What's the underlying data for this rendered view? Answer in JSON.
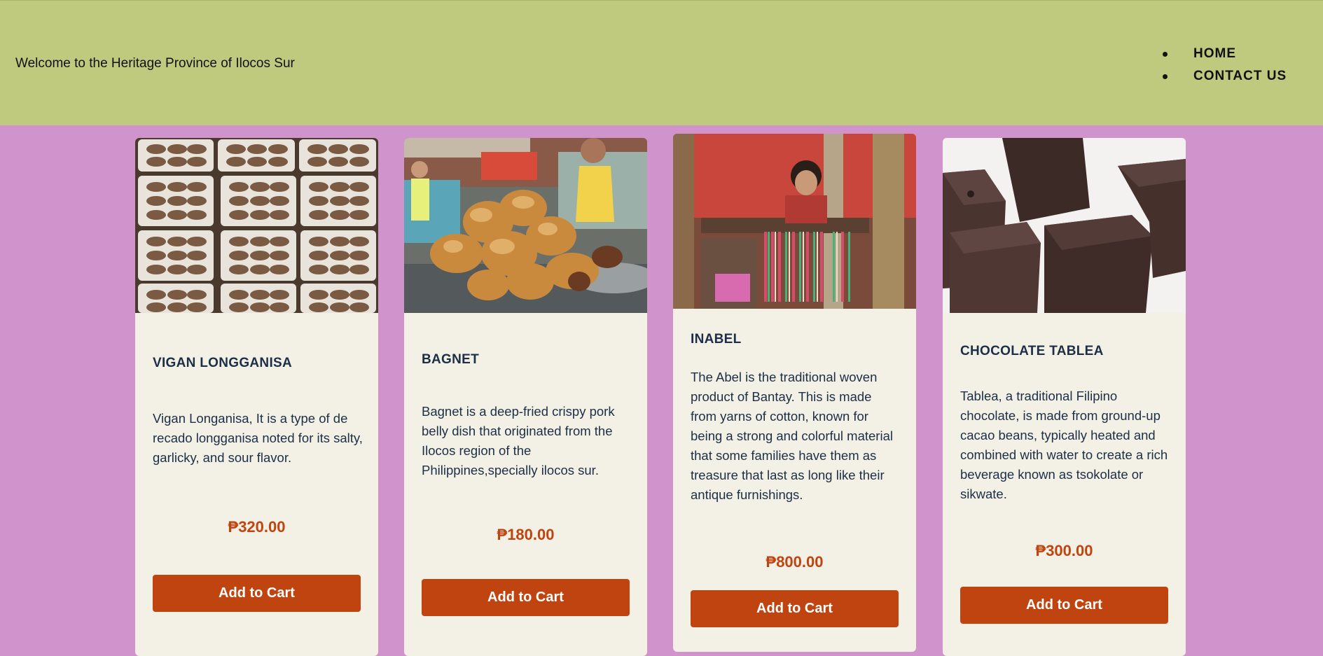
{
  "header": {
    "welcome_text": "Welcome to the Heritage Province of Ilocos Sur",
    "nav": [
      {
        "label": "HOME"
      },
      {
        "label": "CONTACT US"
      }
    ]
  },
  "currency": "₱",
  "products": [
    {
      "title": "VIGAN LONGGANISA",
      "description": "Vigan Longanisa, It is a type of de recado longganisa noted for its salty, garlicky, and sour flavor.",
      "price": "₱320.00",
      "button": "Add to Cart",
      "image": "longganisa-trays-photo"
    },
    {
      "title": "BAGNET",
      "description": "Bagnet is a deep-fried crispy pork belly dish that originated from the Ilocos region of the Philippines,specially ilocos sur.",
      "price": "₱180.00",
      "button": "Add to Cart",
      "image": "bagnet-market-photo"
    },
    {
      "title": "INABEL",
      "description": "The Abel is the traditional woven product of Bantay. This is made from yarns of cotton, known for being a strong and colorful material that some families have them as treasure that last as long like their antique furnishings.",
      "price": "₱800.00",
      "button": "Add to Cart",
      "image": "loom-weaver-photo"
    },
    {
      "title": "CHOCOLATE TABLEA",
      "description": "Tablea, a traditional Filipino chocolate, is made from ground-up cacao beans, typically heated and combined with water to create a rich beverage known as tsokolate or sikwate.",
      "price": "₱300.00",
      "button": "Add to Cart",
      "image": "tablea-blocks-photo"
    }
  ],
  "colors": {
    "header_bg": "#bfca7e",
    "page_bg": "#d193cb",
    "card_bg": "#f3f0e6",
    "accent": "#c0440f",
    "text_dark": "#1c2f46"
  }
}
